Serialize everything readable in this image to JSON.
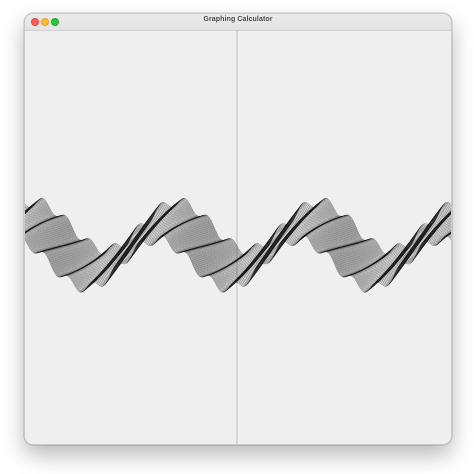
{
  "window": {
    "title": "Graphing Calculator",
    "controls": {
      "close_color": "#fe5f57",
      "minimize_color": "#febc2e",
      "zoom_color": "#28c840"
    }
  },
  "graph": {
    "background_color": "#efefef",
    "axis_color": "#9a9a9a",
    "curve_color": "#111111",
    "curve_family": {
      "shape": "sine",
      "cycles_visible": 3,
      "curve_count": 60
    }
  }
}
